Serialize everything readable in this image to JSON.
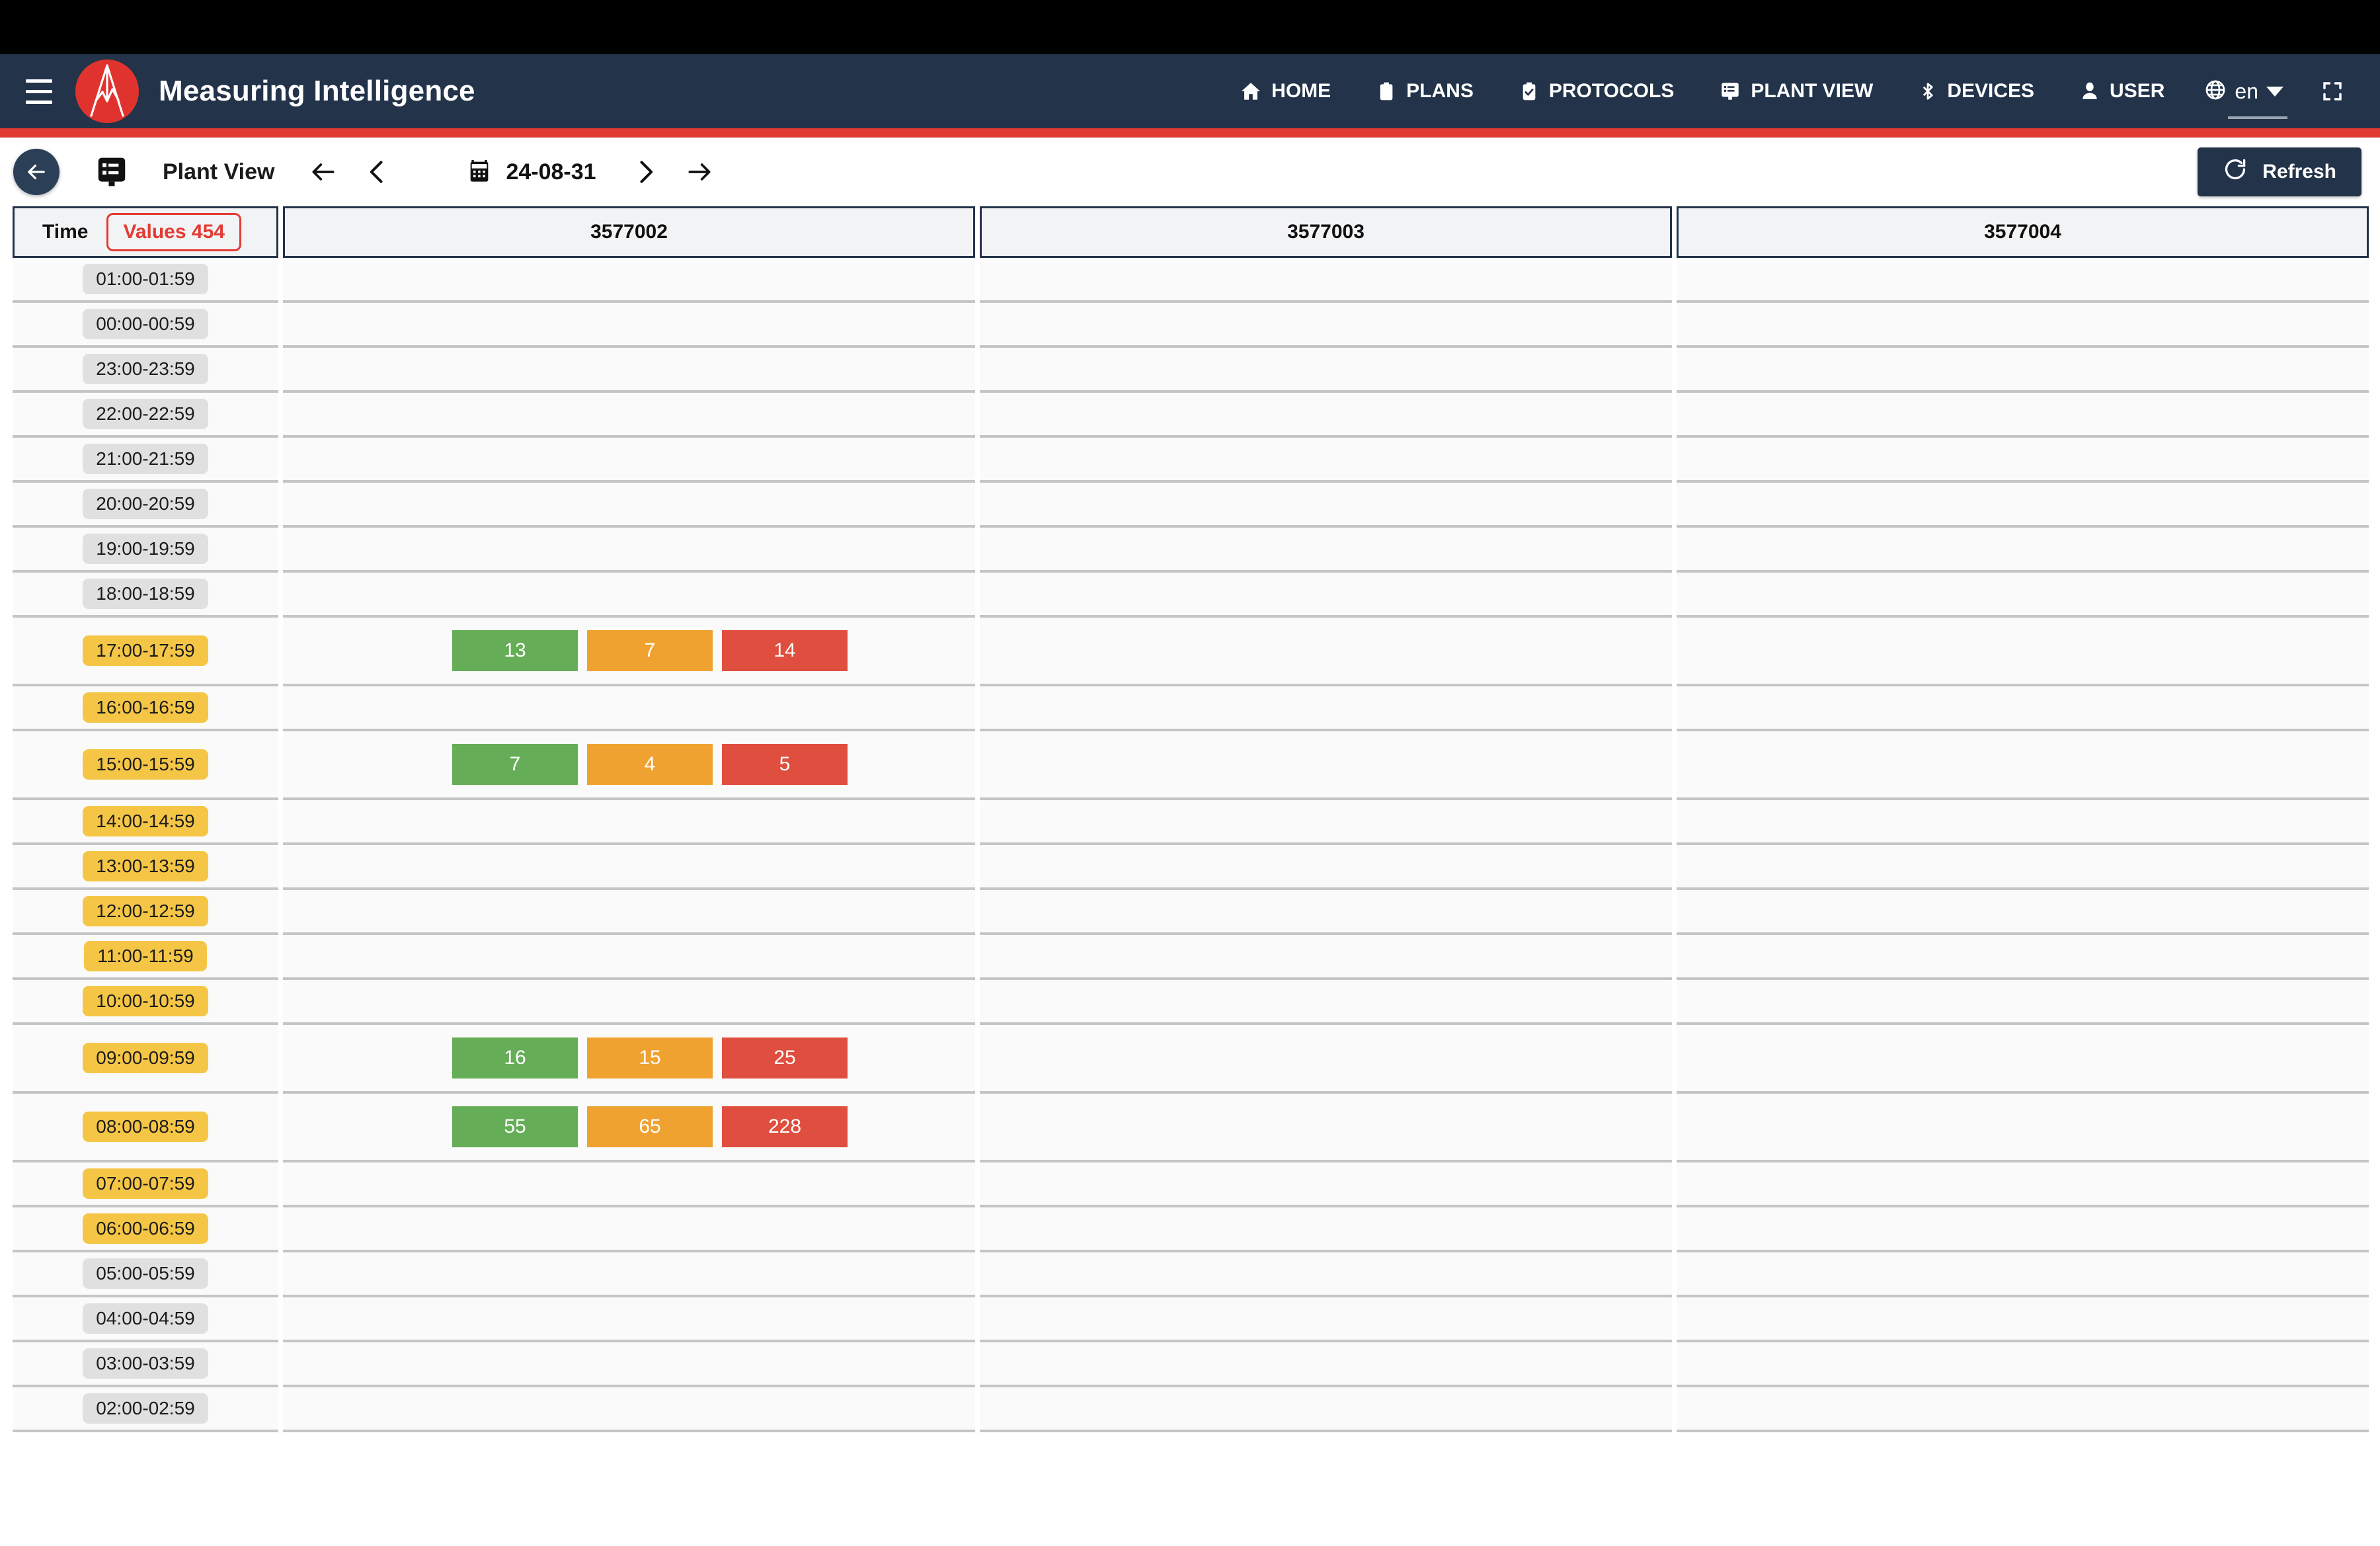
{
  "app": {
    "title": "Measuring Intelligence",
    "accent_color": "#e03a33",
    "navbar_color": "#22334a"
  },
  "navbar": {
    "menu_button": "menu-icon",
    "items": [
      {
        "label": "HOME",
        "icon": "home-icon"
      },
      {
        "label": "PLANS",
        "icon": "clipboard-icon"
      },
      {
        "label": "PROTOCOLS",
        "icon": "clipboard-check-icon"
      },
      {
        "label": "PLANT VIEW",
        "icon": "plant-view-icon"
      },
      {
        "label": "DEVICES",
        "icon": "bluetooth-icon"
      },
      {
        "label": "USER",
        "icon": "user-icon"
      }
    ],
    "language": {
      "value": "en",
      "icon": "globe-icon"
    },
    "fullscreen": "fullscreen-icon"
  },
  "toolbar": {
    "back": "arrow-left-circle",
    "view_icon": "plant-view-icon",
    "title": "Plant View",
    "nav_first": "arrow-left-icon",
    "nav_prev": "chevron-left-icon",
    "nav_next": "chevron-right-icon",
    "nav_last": "arrow-right-icon",
    "date": "24-08-31",
    "calendar_icon": "calendar-icon",
    "refresh_label": "Refresh",
    "refresh_icon": "refresh-icon"
  },
  "table": {
    "time_header": "Time",
    "values_badge": "Values 454",
    "columns": [
      "3577002",
      "3577003",
      "3577004"
    ],
    "colors": {
      "green": "#66ad57",
      "orange": "#f0a230",
      "red": "#df4e3e",
      "time_pill": "#e0e0e0",
      "time_pill_amber": "#f5c646",
      "badge_border": "#e33b33"
    },
    "rows": [
      {
        "time": "01:00-01:59",
        "shift": false,
        "values": null
      },
      {
        "time": "00:00-00:59",
        "shift": false,
        "values": null
      },
      {
        "time": "23:00-23:59",
        "shift": false,
        "values": null
      },
      {
        "time": "22:00-22:59",
        "shift": false,
        "values": null
      },
      {
        "time": "21:00-21:59",
        "shift": false,
        "values": null
      },
      {
        "time": "20:00-20:59",
        "shift": false,
        "values": null
      },
      {
        "time": "19:00-19:59",
        "shift": false,
        "values": null
      },
      {
        "time": "18:00-18:59",
        "shift": false,
        "values": null
      },
      {
        "time": "17:00-17:59",
        "shift": true,
        "values": {
          "green": "13",
          "orange": "7",
          "red": "14"
        }
      },
      {
        "time": "16:00-16:59",
        "shift": true,
        "values": null
      },
      {
        "time": "15:00-15:59",
        "shift": true,
        "values": {
          "green": "7",
          "orange": "4",
          "red": "5"
        }
      },
      {
        "time": "14:00-14:59",
        "shift": true,
        "values": null
      },
      {
        "time": "13:00-13:59",
        "shift": true,
        "values": null
      },
      {
        "time": "12:00-12:59",
        "shift": true,
        "values": null
      },
      {
        "time": "11:00-11:59",
        "shift": true,
        "values": null
      },
      {
        "time": "10:00-10:59",
        "shift": true,
        "values": null
      },
      {
        "time": "09:00-09:59",
        "shift": true,
        "values": {
          "green": "16",
          "orange": "15",
          "red": "25"
        }
      },
      {
        "time": "08:00-08:59",
        "shift": true,
        "values": {
          "green": "55",
          "orange": "65",
          "red": "228"
        }
      },
      {
        "time": "07:00-07:59",
        "shift": true,
        "values": null
      },
      {
        "time": "06:00-06:59",
        "shift": true,
        "values": null
      },
      {
        "time": "05:00-05:59",
        "shift": false,
        "values": null
      },
      {
        "time": "04:00-04:59",
        "shift": false,
        "values": null
      },
      {
        "time": "03:00-03:59",
        "shift": false,
        "values": null
      },
      {
        "time": "02:00-02:59",
        "shift": false,
        "values": null
      }
    ]
  }
}
